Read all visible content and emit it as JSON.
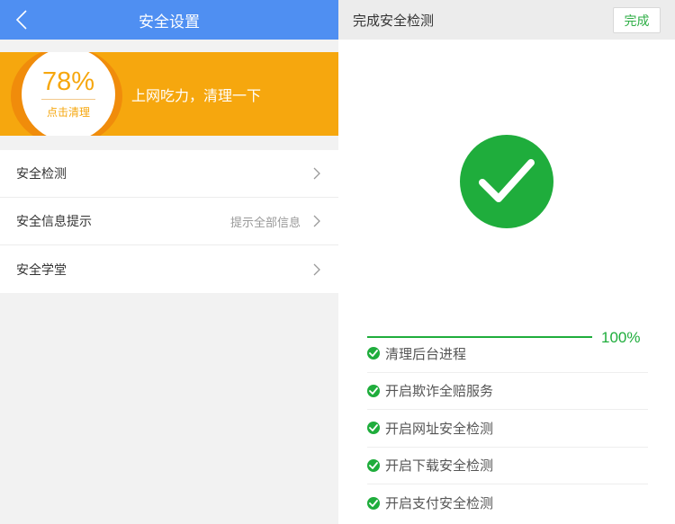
{
  "left": {
    "header_title": "安全设置",
    "header_bg": "#4f8ff2",
    "banner": {
      "percent": "78%",
      "clean_label": "点击清理",
      "message": "上网吃力，清理一下",
      "bg": "#f6a70e"
    },
    "menu": [
      {
        "label": "安全检测",
        "hint": ""
      },
      {
        "label": "安全信息提示",
        "hint": "提示全部信息"
      },
      {
        "label": "安全学堂",
        "hint": ""
      }
    ]
  },
  "right": {
    "header_title": "完成安全检测",
    "done_label": "完成",
    "accent": "#1fad3c",
    "progress": {
      "value": 1.0,
      "label": "100%"
    },
    "tasks": [
      {
        "label": "清理后台进程"
      },
      {
        "label": "开启欺诈全赔服务"
      },
      {
        "label": "开启网址安全检测"
      },
      {
        "label": "开启下载安全检测"
      },
      {
        "label": "开启支付安全检测"
      }
    ]
  }
}
